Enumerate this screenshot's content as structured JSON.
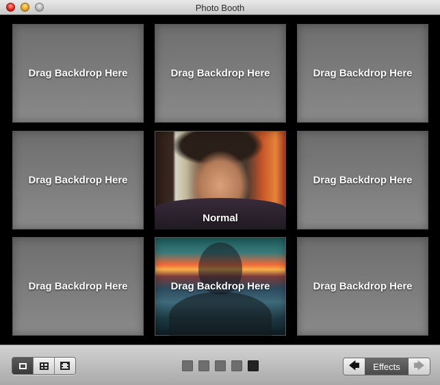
{
  "window": {
    "title": "Photo Booth"
  },
  "tiles": [
    {
      "label": "Drag Backdrop Here"
    },
    {
      "label": "Drag Backdrop Here"
    },
    {
      "label": "Drag Backdrop Here"
    },
    {
      "label": "Drag Backdrop Here"
    },
    {
      "label": "Normal"
    },
    {
      "label": "Drag Backdrop Here"
    },
    {
      "label": "Drag Backdrop Here"
    },
    {
      "label": "Drag Backdrop Here"
    },
    {
      "label": "Drag Backdrop Here"
    }
  ],
  "toolbar": {
    "view_modes": [
      {
        "icon": "single-photo-icon",
        "active": true
      },
      {
        "icon": "grid-icon",
        "active": false
      },
      {
        "icon": "movie-icon",
        "active": false
      }
    ],
    "pages": {
      "count": 5,
      "current": 5
    },
    "effects_label": "Effects",
    "prev_arrow": "🡄",
    "next_arrow": "🡆"
  },
  "colors": {
    "titlebar": "#d8d8d8",
    "background": "#000000",
    "tile": "#7a7a7a"
  }
}
